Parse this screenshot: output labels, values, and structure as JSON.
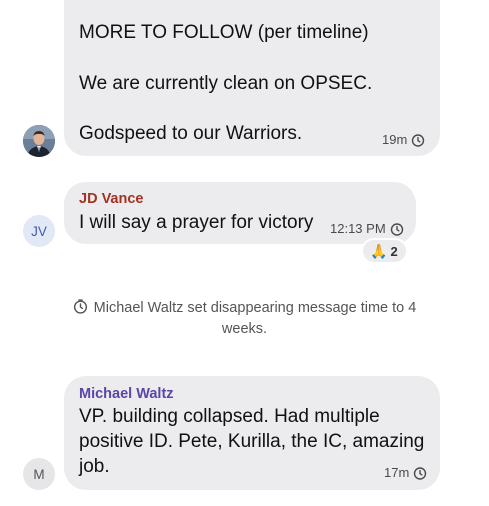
{
  "messages": [
    {
      "lines": [
        "MORE TO FOLLOW (per timeline)",
        "We are currently clean on OPSEC.",
        "Godspeed to our Warriors."
      ],
      "time": "19m",
      "timer_icon": "clock-timer-icon",
      "avatar_icon": "profile-photo"
    },
    {
      "sender": "JD Vance",
      "sender_color": "#a13324",
      "text": "I will say a prayer for victory",
      "time": "12:13 PM",
      "timer_icon": "clock-timer-icon",
      "avatar_initials": "JV",
      "avatar_color": "#3f5fa8",
      "avatar_bg": "#e2e8f6",
      "reaction": {
        "emoji": "🙏",
        "emoji_name": "praying-hands-icon",
        "count": "2"
      }
    },
    {
      "sender": "Michael Waltz",
      "sender_color": "#5b46a8",
      "lines": [
        "VP.  building collapsed. Had multiple",
        "positive ID. Pete, Kurilla, the IC, amazing",
        "job."
      ],
      "time": "17m",
      "timer_icon": "clock-timer-icon",
      "avatar_initials": "M",
      "avatar_color": "#555555",
      "avatar_bg": "#e6e6e8"
    }
  ],
  "system_notice": {
    "line1": "Michael Waltz set disappearing message time to 4",
    "line2": "weeks.",
    "icon": "clock-timer-icon"
  }
}
